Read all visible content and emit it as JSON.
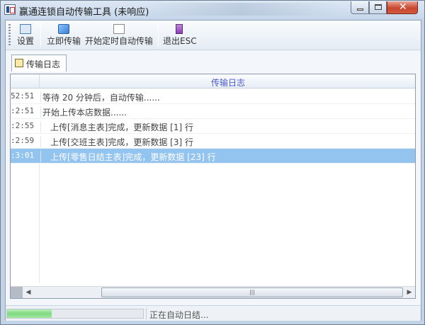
{
  "window": {
    "title": "赢通连锁自动传输工具 (未响应)"
  },
  "toolbar": {
    "items": [
      {
        "label": "设置",
        "icon": "settings-icon"
      },
      {
        "label": "立即传输",
        "icon": "upload-icon"
      },
      {
        "label": "开始定时自动传输",
        "icon": "timer-icon"
      },
      {
        "label": "退出ESC",
        "icon": "exit-icon"
      }
    ]
  },
  "tabs": [
    {
      "label": "传输日志",
      "icon": "log-icon",
      "active": true
    }
  ],
  "log": {
    "column_header": "传输日志",
    "rows": [
      {
        "time": "52:51",
        "message": "等待 20 分钟后，自动传输......"
      },
      {
        "time": ":2:51",
        "message": "开始上传本店数据......"
      },
      {
        "time": ":2:55",
        "message": "上传[消息主表]完成，更新数据 [1] 行"
      },
      {
        "time": ":2:59",
        "message": "上传[交班主表]完成，更新数据 [3] 行"
      },
      {
        "time": ":3:01",
        "message": "上传[零售日结主表]完成，更新数据 [23] 行"
      }
    ],
    "selected_row": 4
  },
  "statusbar": {
    "progress": 0.33,
    "text": "正在自动日结..."
  },
  "colors": {
    "selection": "#93c3ef",
    "header_text": "#4a5bc8",
    "progress_fill": "#7fd97f",
    "close_button": "#c9472d"
  }
}
